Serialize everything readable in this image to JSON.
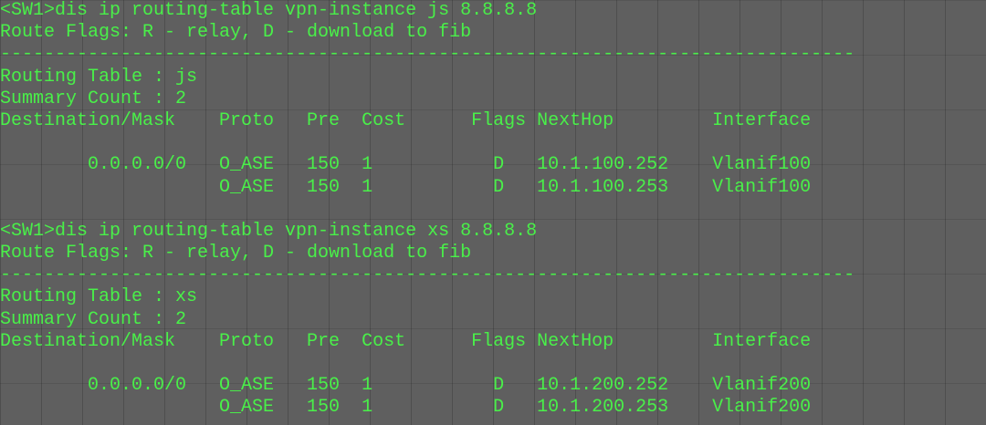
{
  "terminal": {
    "lines": [
      "<SW1>dis ip routing-table vpn-instance js 8.8.8.8",
      "Route Flags: R - relay, D - download to fib",
      "------------------------------------------------------------------------------",
      "Routing Table : js",
      "Summary Count : 2",
      "Destination/Mask    Proto   Pre  Cost      Flags NextHop         Interface",
      "",
      "        0.0.0.0/0   O_ASE   150  1           D   10.1.100.252    Vlanif100",
      "                    O_ASE   150  1           D   10.1.100.253    Vlanif100",
      "",
      "<SW1>dis ip routing-table vpn-instance xs 8.8.8.8",
      "Route Flags: R - relay, D - download to fib",
      "------------------------------------------------------------------------------",
      "Routing Table : xs",
      "Summary Count : 2",
      "Destination/Mask    Proto   Pre  Cost      Flags NextHop         Interface",
      "",
      "        0.0.0.0/0   O_ASE   150  1           D   10.1.200.252    Vlanif200",
      "                    O_ASE   150  1           D   10.1.200.253    Vlanif200"
    ]
  }
}
